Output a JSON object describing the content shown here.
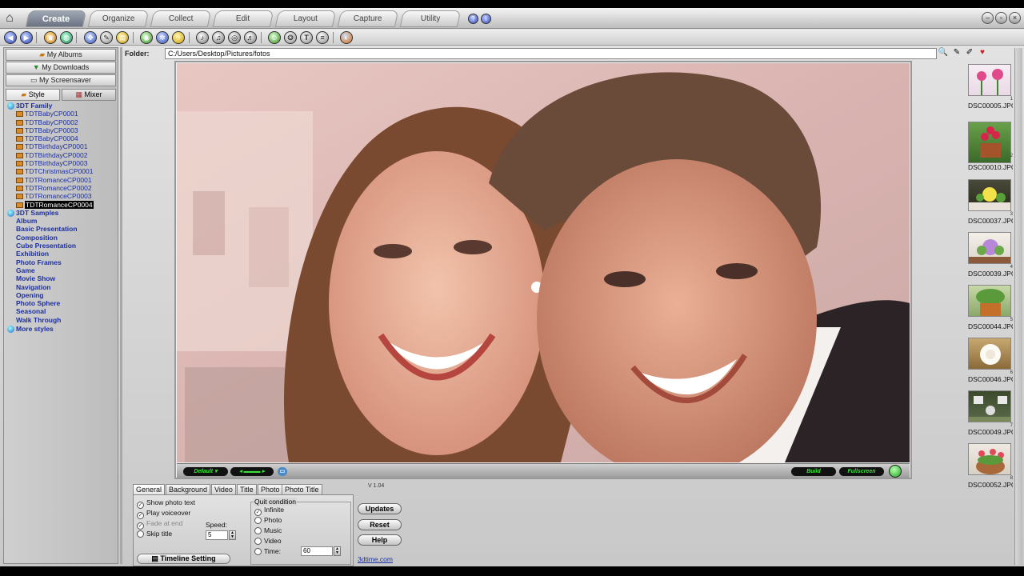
{
  "tabs": [
    "Create",
    "Organize",
    "Collect",
    "Edit",
    "Layout",
    "Capture",
    "Utility"
  ],
  "active_tab": "Create",
  "left_panel": {
    "buttons": [
      "My Albums",
      "My Downloads",
      "My Screensaver"
    ],
    "tabs": [
      "Style",
      "Mixer"
    ],
    "tree": {
      "group1": "3DT Family",
      "group1_items": [
        "TDTBabyCP0001",
        "TDTBabyCP0002",
        "TDTBabyCP0003",
        "TDTBabyCP0004",
        "TDTBirthdayCP0001",
        "TDTBirthdayCP0002",
        "TDTBirthdayCP0003",
        "TDTChristmasCP0001",
        "TDTRomanceCP0001",
        "TDTRomanceCP0002",
        "TDTRomanceCP0003",
        "TDTRomanceCP0004"
      ],
      "selected": "TDTRomanceCP0004",
      "group2": "3DT Samples",
      "categories": [
        "Album",
        "Basic Presentation",
        "Composition",
        "Cube Presentation",
        "Exhibition",
        "Photo Frames",
        "Game",
        "Movie Show",
        "Navigation",
        "Opening",
        "Photo Sphere",
        "Seasonal",
        "Walk Through"
      ],
      "more": "More styles"
    }
  },
  "folder": {
    "label": "Folder:",
    "path": "C:/Users/Desktop/Pictures/fotos"
  },
  "preview": {
    "left_pill": "Default",
    "build_pill": "Build",
    "fullscreen_pill": "Fullscreen"
  },
  "thumbnails": [
    {
      "num": "1",
      "caption": "DSC00005.JPG"
    },
    {
      "num": "2",
      "caption": "DSC00010.JPG"
    },
    {
      "num": "3",
      "caption": "DSC00037.JPG"
    },
    {
      "num": "4",
      "caption": "DSC00039.JPG"
    },
    {
      "num": "5",
      "caption": "DSC00044.JPG"
    },
    {
      "num": "6",
      "caption": "DSC00046.JPG"
    },
    {
      "num": "7",
      "caption": "DSC00049.JPG"
    },
    {
      "num": "8",
      "caption": "DSC00052.JPG"
    }
  ],
  "bottom": {
    "version": "V 1.04",
    "tabs": [
      "General",
      "Background",
      "Video",
      "Title",
      "Photo",
      "Photo Title"
    ],
    "options": {
      "show_photo_text": "Show photo text",
      "play_voiceover": "Play voiceover",
      "fade_at_end": "Fade at end",
      "skip_title": "Skip title",
      "speed_label": "Speed:",
      "speed_value": "5"
    },
    "quit": {
      "legend": "Quit condition",
      "options": [
        "Infinite",
        "Photo",
        "Music",
        "Video"
      ],
      "time_label": "Time:",
      "time_value": "60"
    },
    "timeline_button": "Timeline Setting",
    "buttons": [
      "Updates",
      "Reset",
      "Help"
    ],
    "link": "3dtime.com"
  },
  "colors": {
    "active_tab": "#7b8395",
    "link": "#1c2fa0",
    "pill_text": "#39e039"
  }
}
